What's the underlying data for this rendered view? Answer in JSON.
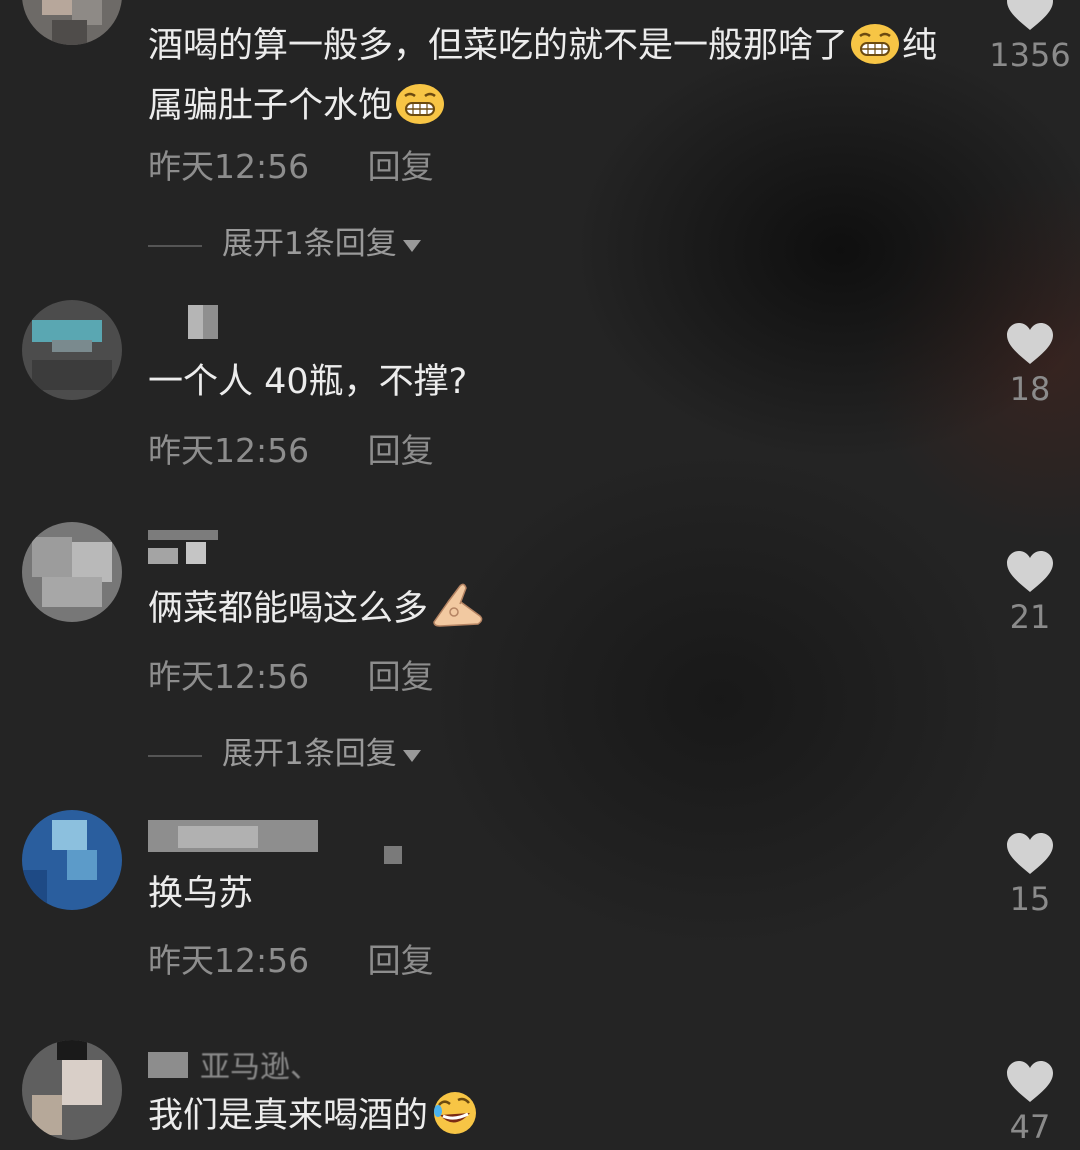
{
  "comments": [
    {
      "text_parts": [
        "酒喝的算一般多，但菜吃的就不是一般那啥了",
        "纯属骗肚子个水饱",
        ""
      ],
      "emojis": [
        "grin-emoji",
        "grin-emoji"
      ],
      "time": "昨天12:56",
      "reply_label": "回复",
      "expand_label": "展开1条回复",
      "likes": "1356"
    },
    {
      "text": "一个人 40瓶，不撑?",
      "time": "昨天12:56",
      "reply_label": "回复",
      "likes": "18"
    },
    {
      "text": "俩菜都能喝这么多",
      "emojis": [
        "ok-hand-emoji"
      ],
      "time": "昨天12:56",
      "reply_label": "回复",
      "expand_label": "展开1条回复",
      "likes": "21"
    },
    {
      "text": "换乌苏",
      "time": "昨天12:56",
      "reply_label": "回复",
      "likes": "15"
    },
    {
      "username": "亚马逊、",
      "text": "我们是真来喝酒的",
      "emojis": [
        "rofl-emoji"
      ],
      "likes": "47"
    }
  ],
  "colors": {
    "background": "#242424",
    "text": "#ececec",
    "meta": "#8d8d8d",
    "heart": "#d2d2d2"
  },
  "icons": [
    "heart-icon",
    "caret-down-icon"
  ]
}
